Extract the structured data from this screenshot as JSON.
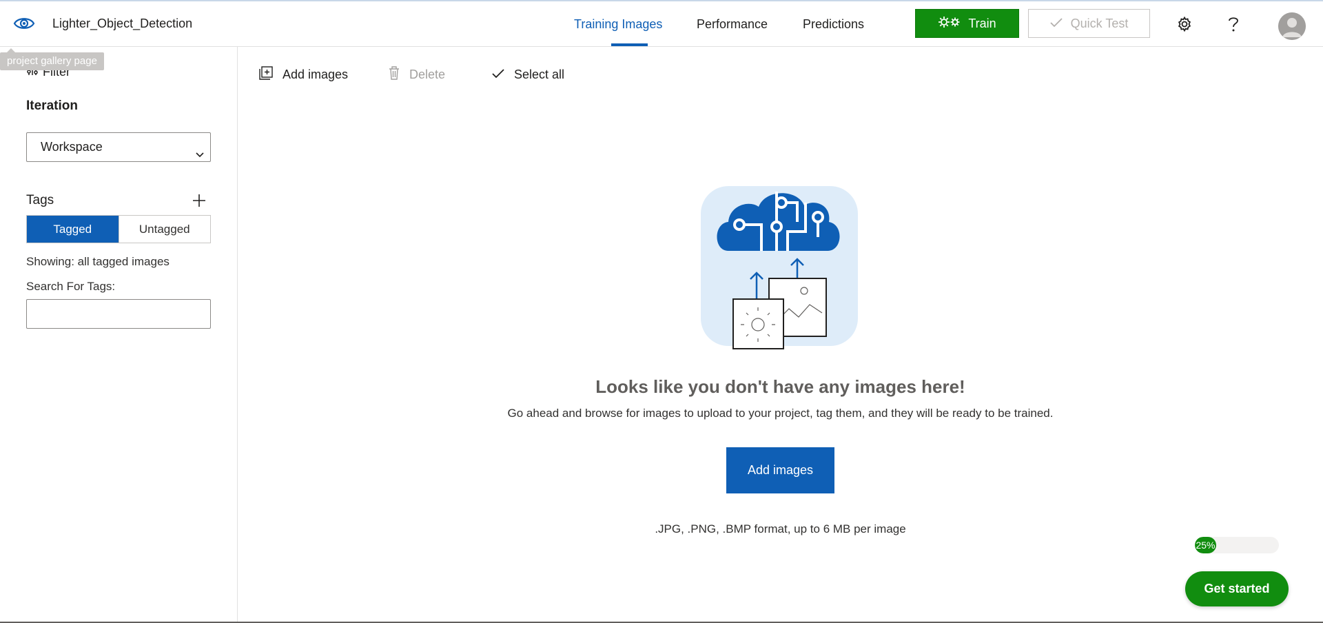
{
  "header": {
    "project_name": "Lighter_Object_Detection",
    "tooltip": "project gallery page",
    "tabs": [
      {
        "label": "Training Images",
        "active": true
      },
      {
        "label": "Performance",
        "active": false
      },
      {
        "label": "Predictions",
        "active": false
      }
    ],
    "train_label": "Train",
    "quick_test_label": "Quick Test",
    "icons": {
      "logo": "eye-icon",
      "settings": "gear-icon",
      "help": "question-icon",
      "avatar": "user-avatar-icon"
    }
  },
  "sidebar": {
    "filter_label": "Filter",
    "iteration_title": "Iteration",
    "iteration_selected": "Workspace",
    "tags_title": "Tags",
    "toggle": {
      "tagged": "Tagged",
      "untagged": "Untagged"
    },
    "showing": "Showing: all tagged images",
    "search_label": "Search For Tags:",
    "search_value": ""
  },
  "toolbar": {
    "add_images": "Add images",
    "delete": "Delete",
    "select_all": "Select all"
  },
  "empty_state": {
    "title": "Looks like you don't have any images here!",
    "subtitle": "Go ahead and browse for images to upload to your project, tag them, and they will be ready to be trained.",
    "button": "Add images",
    "formats": ".JPG, .PNG, .BMP format, up to 6 MB per image"
  },
  "onboarding": {
    "progress_label": "25%",
    "progress_value": 0.25,
    "get_started": "Get started"
  },
  "colors": {
    "brand_blue": "#0f5fb5",
    "train_green": "#118d0f",
    "illustration_bg": "#deecf9"
  }
}
